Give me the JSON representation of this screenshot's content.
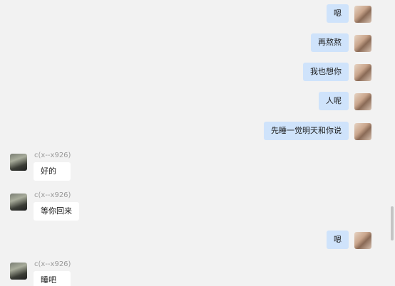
{
  "contact_name": "c(x--x926)",
  "messages": [
    {
      "side": "right",
      "text": "嗯"
    },
    {
      "side": "right",
      "text": "再熬熬"
    },
    {
      "side": "right",
      "text": "我也想你"
    },
    {
      "side": "right",
      "text": "人呢"
    },
    {
      "side": "right",
      "text": "先睡一觉明天和你说"
    },
    {
      "side": "left",
      "sender": "c(x--x926)",
      "text": "好的"
    },
    {
      "side": "left",
      "sender": "c(x--x926)",
      "text": "等你回来"
    },
    {
      "side": "right",
      "text": "嗯"
    },
    {
      "side": "left",
      "sender": "c(x--x926)",
      "text": "睡吧"
    }
  ],
  "colors": {
    "background": "#f2f2f2",
    "my_bubble": "#cfe3fb",
    "their_bubble": "#ffffff",
    "nickname": "#9a9a9a"
  }
}
